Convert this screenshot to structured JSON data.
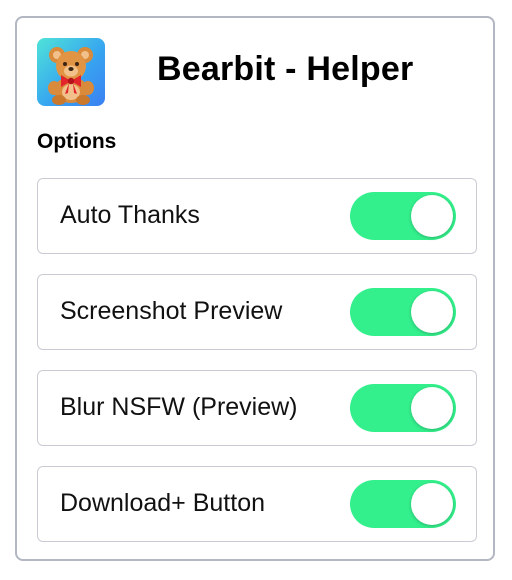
{
  "header": {
    "title": "Bearbit - Helper",
    "logo_icon": "teddy-bear-icon"
  },
  "options_section": {
    "heading": "Options",
    "items": [
      {
        "label": "Auto Thanks",
        "enabled": true
      },
      {
        "label": "Screenshot Preview",
        "enabled": true
      },
      {
        "label": "Blur NSFW (Preview)",
        "enabled": true
      },
      {
        "label": "Download+ Button",
        "enabled": true
      }
    ]
  },
  "colors": {
    "toggle_on": "#33f08c",
    "panel_border": "#b3b7c2",
    "logo_gradient_start": "#4fe3d8",
    "logo_gradient_end": "#3b7ff2"
  }
}
